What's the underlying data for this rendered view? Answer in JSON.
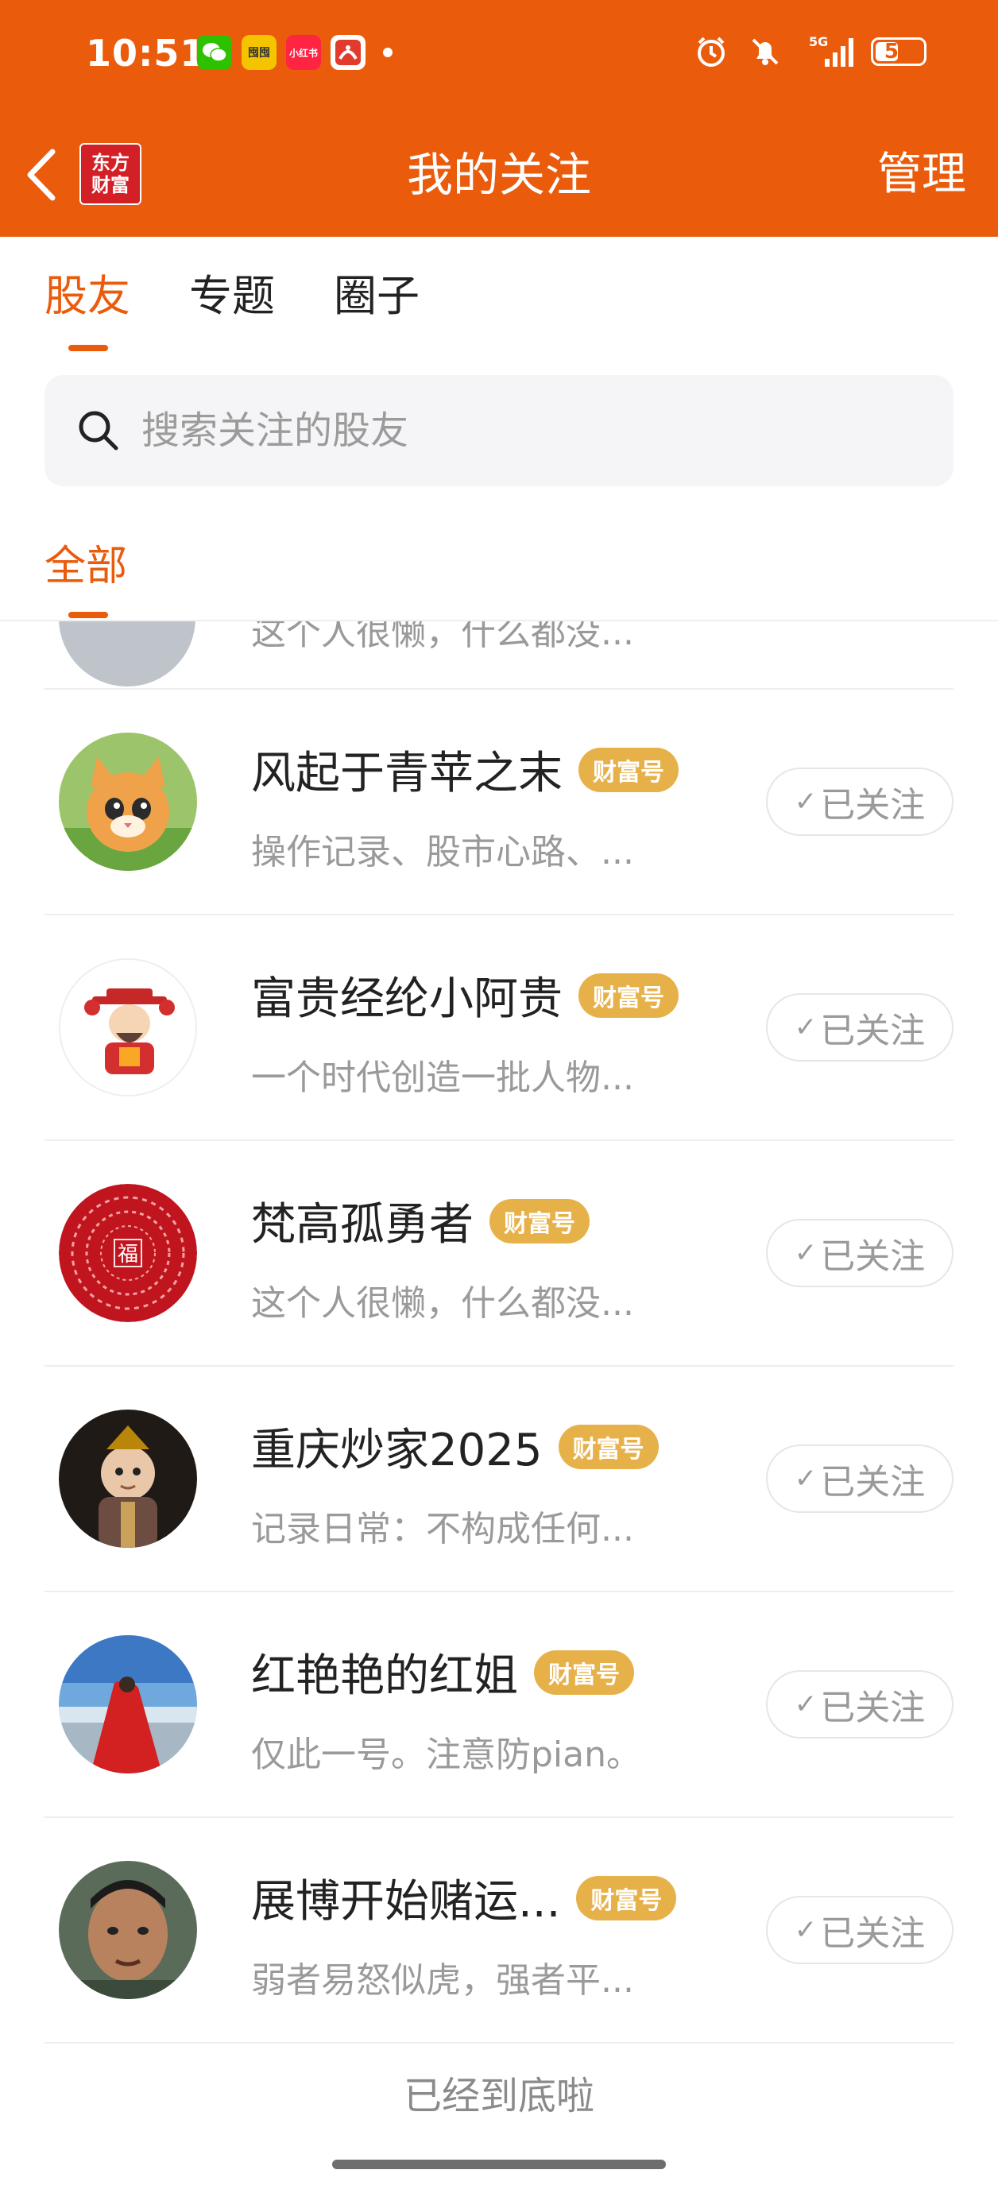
{
  "status_bar": {
    "time": "10:51",
    "apps": [
      {
        "name": "wechat-icon",
        "label": "",
        "color": "#2dc100"
      },
      {
        "name": "app-icon-yellow",
        "label": "囤囤",
        "color": "#f5c400"
      },
      {
        "name": "xiaohongshu-icon",
        "label": "小红书",
        "color": "#ff2442"
      },
      {
        "name": "eastmoney-icon",
        "label": "",
        "color": "#e23b2e"
      }
    ],
    "network": "5G",
    "battery": "53",
    "battery_level": 0.53
  },
  "header": {
    "logo_line1": "东方",
    "logo_line2": "财富",
    "title": "我的关注",
    "manage_label": "管理"
  },
  "tabs": [
    {
      "label": "股友",
      "active": true
    },
    {
      "label": "专题",
      "active": false
    },
    {
      "label": "圈子",
      "active": false
    }
  ],
  "search": {
    "placeholder": "搜索关注的股友"
  },
  "filter": {
    "label": "全部"
  },
  "partial_row": {
    "desc": "这个人很懒，什么都没..."
  },
  "users": [
    {
      "name": "风起于青苹之末",
      "badge": "财富号",
      "desc": "操作记录、股市心路、...",
      "follow_label": "已关注"
    },
    {
      "name": "富贵经纶小阿贵",
      "badge": "财富号",
      "desc": "一个时代创造一批人物...",
      "follow_label": "已关注"
    },
    {
      "name": "梵高孤勇者",
      "badge": "财富号",
      "desc": "这个人很懒，什么都没...",
      "follow_label": "已关注"
    },
    {
      "name": "重庆炒家2025",
      "badge": "财富号",
      "desc": "记录日常：不构成任何...",
      "follow_label": "已关注"
    },
    {
      "name": "红艳艳的红姐",
      "badge": "财富号",
      "desc": "仅此一号。注意防pian。",
      "follow_label": "已关注"
    },
    {
      "name": "展博开始赌运...",
      "badge": "财富号",
      "desc": "弱者易怒似虎，强者平...",
      "follow_label": "已关注"
    }
  ],
  "avatar_3_text": "福",
  "footer": {
    "end_text": "已经到底啦"
  },
  "colors": {
    "accent": "#ea5b0c",
    "badge": "#e7b14a"
  }
}
